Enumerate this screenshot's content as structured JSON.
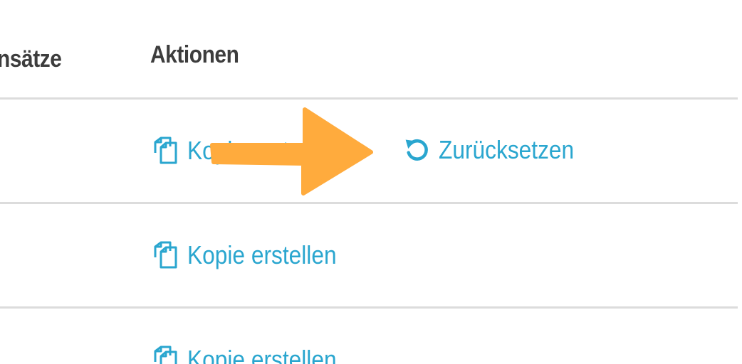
{
  "table": {
    "headers": {
      "saetze": "nsätze",
      "actions": "Aktionen"
    },
    "rows": [
      {
        "actions": [
          {
            "label": "Kopie erstellen",
            "icon": "copy-icon"
          },
          {
            "label": "Zurücksetzen",
            "icon": "reset-icon"
          }
        ]
      },
      {
        "actions": [
          {
            "label": "Kopie erstellen",
            "icon": "copy-icon"
          }
        ]
      },
      {
        "actions": [
          {
            "label": "Kopie erstellen",
            "icon": "copy-icon"
          }
        ]
      }
    ]
  },
  "annotation": {
    "type": "arrow",
    "direction": "right",
    "color": "#ffab3d"
  },
  "colors": {
    "link": "#2aa6cf",
    "header_text": "#3d3d3d",
    "divider": "#dcdcdc"
  }
}
